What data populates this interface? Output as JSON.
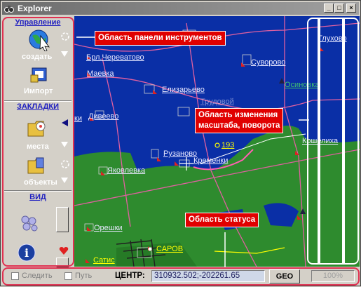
{
  "window": {
    "title": "Explorer"
  },
  "sidebar": {
    "sections": {
      "manage": "Управление",
      "bookmarks": "ЗАКЛАДКИ",
      "view": "ВИД"
    },
    "tools": {
      "create": "создать",
      "import": "Импорт",
      "places": "места",
      "objects": "объекты"
    }
  },
  "map": {
    "places": [
      {
        "name": "Брл.Череватово"
      },
      {
        "name": "Маевка"
      },
      {
        "name": "Суворово"
      },
      {
        "name": "Елизарьево"
      },
      {
        "name": "Дивеево"
      },
      {
        "name": "Трудовой"
      },
      {
        "name": "Глухово"
      },
      {
        "name": "Осиновка"
      },
      {
        "name": "Кошелиха"
      },
      {
        "name": "Рузаново"
      },
      {
        "name": "Кременки"
      },
      {
        "name": "Яковлевка"
      },
      {
        "name": "Орешки"
      },
      {
        "name": "САРОВ"
      },
      {
        "name": "Сатис"
      },
      {
        "name": "ки"
      }
    ],
    "point_label": "193",
    "colors": {
      "water": "#0a2fa6",
      "forest": "#2e8b2e",
      "roads": "#e060a0",
      "highlight": "#ffff00"
    }
  },
  "callouts": {
    "toolbar": "Область панели инструментов",
    "zoom_line1": "Область изменения",
    "zoom_line2": "масштаба, поворота",
    "status": "Область статуса"
  },
  "status": {
    "follow_label": "Следить",
    "path_label": "Путь",
    "center_label": "ЦЕНТР:",
    "coordinates": "310932.502;-202261.65",
    "geo_button": "GEO",
    "zoom": "100%"
  }
}
